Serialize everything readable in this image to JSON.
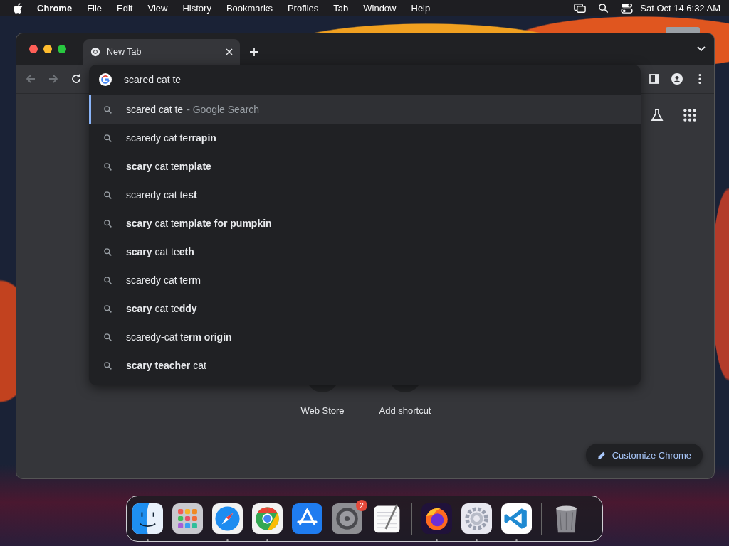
{
  "menu_bar": {
    "app": "Chrome",
    "items": [
      "File",
      "Edit",
      "View",
      "History",
      "Bookmarks",
      "Profiles",
      "Tab",
      "Window",
      "Help"
    ],
    "clock": "Sat Oct 14  6:32 AM"
  },
  "browser": {
    "tabs": [
      {
        "title": "New Tab",
        "selected": true
      }
    ],
    "omnibox": {
      "value": "scared cat te"
    },
    "suggestions": [
      {
        "text": "scared cat te",
        "hint": "- Google Search",
        "selected": true
      },
      {
        "text": "scaredy cat te**rrapin**",
        "selected": false
      },
      {
        "text": "**scary** cat te**mplate**",
        "selected": false
      },
      {
        "text": "scaredy cat te**st**",
        "selected": false
      },
      {
        "text": "**scary** cat te**mplate for pumpkin**",
        "selected": false
      },
      {
        "text": "**scary** cat te**eth**",
        "selected": false
      },
      {
        "text": "scaredy cat te**rm**",
        "selected": false
      },
      {
        "text": "**scary** cat te**ddy**",
        "selected": false
      },
      {
        "text": "scaredy-cat te**rm origin**",
        "selected": false
      },
      {
        "text": "**scary teacher** cat",
        "selected": false
      }
    ],
    "shortcuts": [
      {
        "label": "Web Store"
      },
      {
        "label": "Add shortcut"
      }
    ],
    "customize_button": "Customize Chrome"
  },
  "dock": [
    {
      "kind": "finder",
      "running": true
    },
    {
      "kind": "launchpad",
      "running": false
    },
    {
      "kind": "safari",
      "running": true
    },
    {
      "kind": "chrome",
      "running": true
    },
    {
      "kind": "appstore",
      "running": false
    },
    {
      "kind": "settings",
      "running": false,
      "badge": "2"
    },
    {
      "kind": "textedit",
      "running": false
    },
    {
      "kind": "separator"
    },
    {
      "kind": "firefox",
      "running": true
    },
    {
      "kind": "gear",
      "running": true
    },
    {
      "kind": "vscode",
      "running": true
    },
    {
      "kind": "separator"
    },
    {
      "kind": "trash",
      "running": false
    }
  ]
}
